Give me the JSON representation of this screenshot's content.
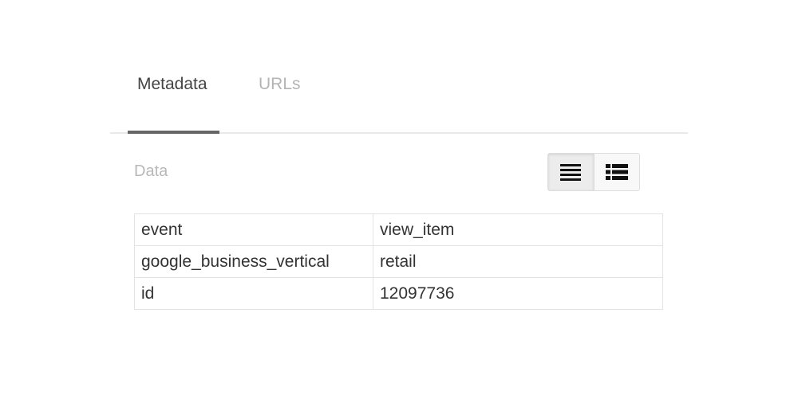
{
  "tabs": [
    {
      "label": "Metadata",
      "active": true
    },
    {
      "label": "URLs",
      "active": false
    }
  ],
  "section": {
    "label": "Data"
  },
  "view_toggle": {
    "options": [
      {
        "icon": "list-view-icon",
        "selected": true
      },
      {
        "icon": "detailed-list-view-icon",
        "selected": false
      }
    ]
  },
  "table": {
    "rows": [
      {
        "key": "event",
        "value": "view_item"
      },
      {
        "key": "google_business_vertical",
        "value": "retail"
      },
      {
        "key": "id",
        "value": "12097736"
      }
    ]
  },
  "colors": {
    "active_tab_text": "#444444",
    "inactive_tab_text": "#b4b4b4",
    "tab_underline": "#666666",
    "border": "#e3e3e3"
  }
}
